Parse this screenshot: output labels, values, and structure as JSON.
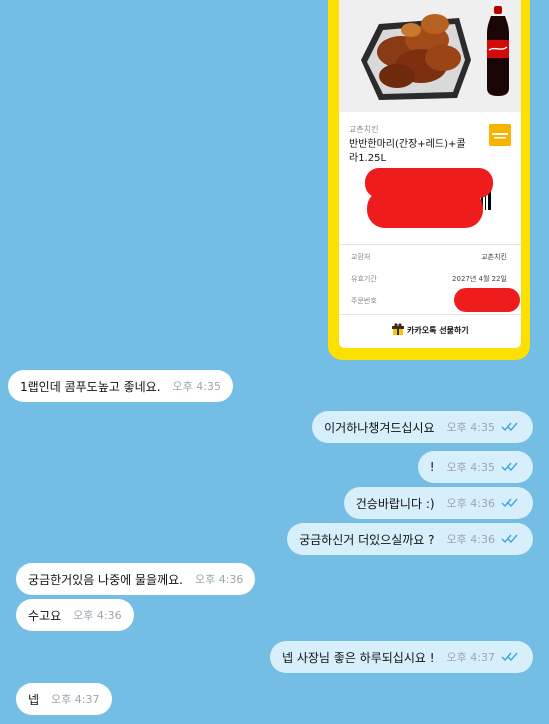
{
  "gift_card": {
    "brand": "교촌치킨",
    "product_name": "반반한마리(간장+레드)+콜라1.25L",
    "barcode_digits": "",
    "rows": [
      {
        "key": "교환처",
        "value": "교촌치킨"
      },
      {
        "key": "유효기간",
        "value": "2027년 4월 22일"
      },
      {
        "key": "주문번호",
        "value": ""
      }
    ],
    "footer_label": "카카오톡 선물하기"
  },
  "messages": [
    {
      "side": "in",
      "text": "1랩인데 콤푸도높고 좋네요.",
      "time": "오후 4:35"
    },
    {
      "side": "out",
      "text": "이거하나챙겨드십시요",
      "time": "오후 4:35",
      "read": true
    },
    {
      "side": "out",
      "text": "!",
      "time": "오후 4:35",
      "read": true
    },
    {
      "side": "out",
      "text": "건승바랍니다 :)",
      "time": "오후 4:36",
      "read": true
    },
    {
      "side": "out",
      "text": "궁금하신거 더있으실까요 ?",
      "time": "오후 4:36",
      "read": true
    },
    {
      "side": "in",
      "text": "궁금한거있음 나중에 물을께요.",
      "time": "오후 4:36"
    },
    {
      "side": "in",
      "text": "수고요",
      "time": "오후 4:36"
    },
    {
      "side": "out",
      "text": "넵 사장님 좋은 하루되십시요 !",
      "time": "오후 4:37",
      "read": true
    },
    {
      "side": "in",
      "text": "넵",
      "time": "오후 4:37"
    }
  ],
  "colors": {
    "background": "#74bde4",
    "incoming_bubble": "#ffffff",
    "outgoing_bubble": "#d7eefb",
    "card_border": "#fde000",
    "read_check": "#3aa7e0",
    "redaction": "#ee1c1c"
  }
}
